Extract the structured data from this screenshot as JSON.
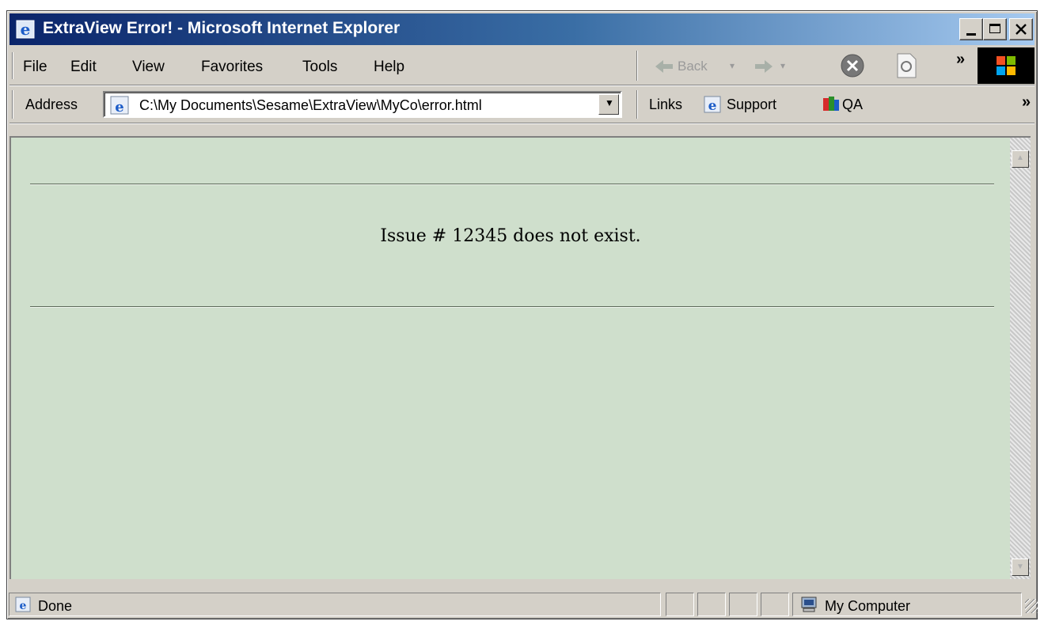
{
  "window": {
    "title": "ExtraView Error! - Microsoft Internet Explorer",
    "icon": "ie-icon",
    "controls": [
      "minimize",
      "maximize",
      "close"
    ]
  },
  "menu": {
    "items": [
      {
        "label": "File",
        "name": "menu-file"
      },
      {
        "label": "Edit",
        "name": "menu-edit"
      },
      {
        "label": "View",
        "name": "menu-view"
      },
      {
        "label": "Favorites",
        "name": "menu-favorites"
      },
      {
        "label": "Tools",
        "name": "menu-tools"
      },
      {
        "label": "Help",
        "name": "menu-help"
      }
    ]
  },
  "toolbar": {
    "back_label": "Back",
    "chevron": "»"
  },
  "address": {
    "label": "Address",
    "value": "C:\\My Documents\\Sesame\\ExtraView\\MyCo\\error.html"
  },
  "links": {
    "label": "Links",
    "items": [
      {
        "label": "Support",
        "icon": "ie-page-icon"
      },
      {
        "label": "QA",
        "icon": "colorful-app-icon"
      }
    ],
    "chevron": "»"
  },
  "page": {
    "message": "Issue # 12345 does not exist."
  },
  "status": {
    "text": "Done",
    "zone": "My Computer"
  }
}
